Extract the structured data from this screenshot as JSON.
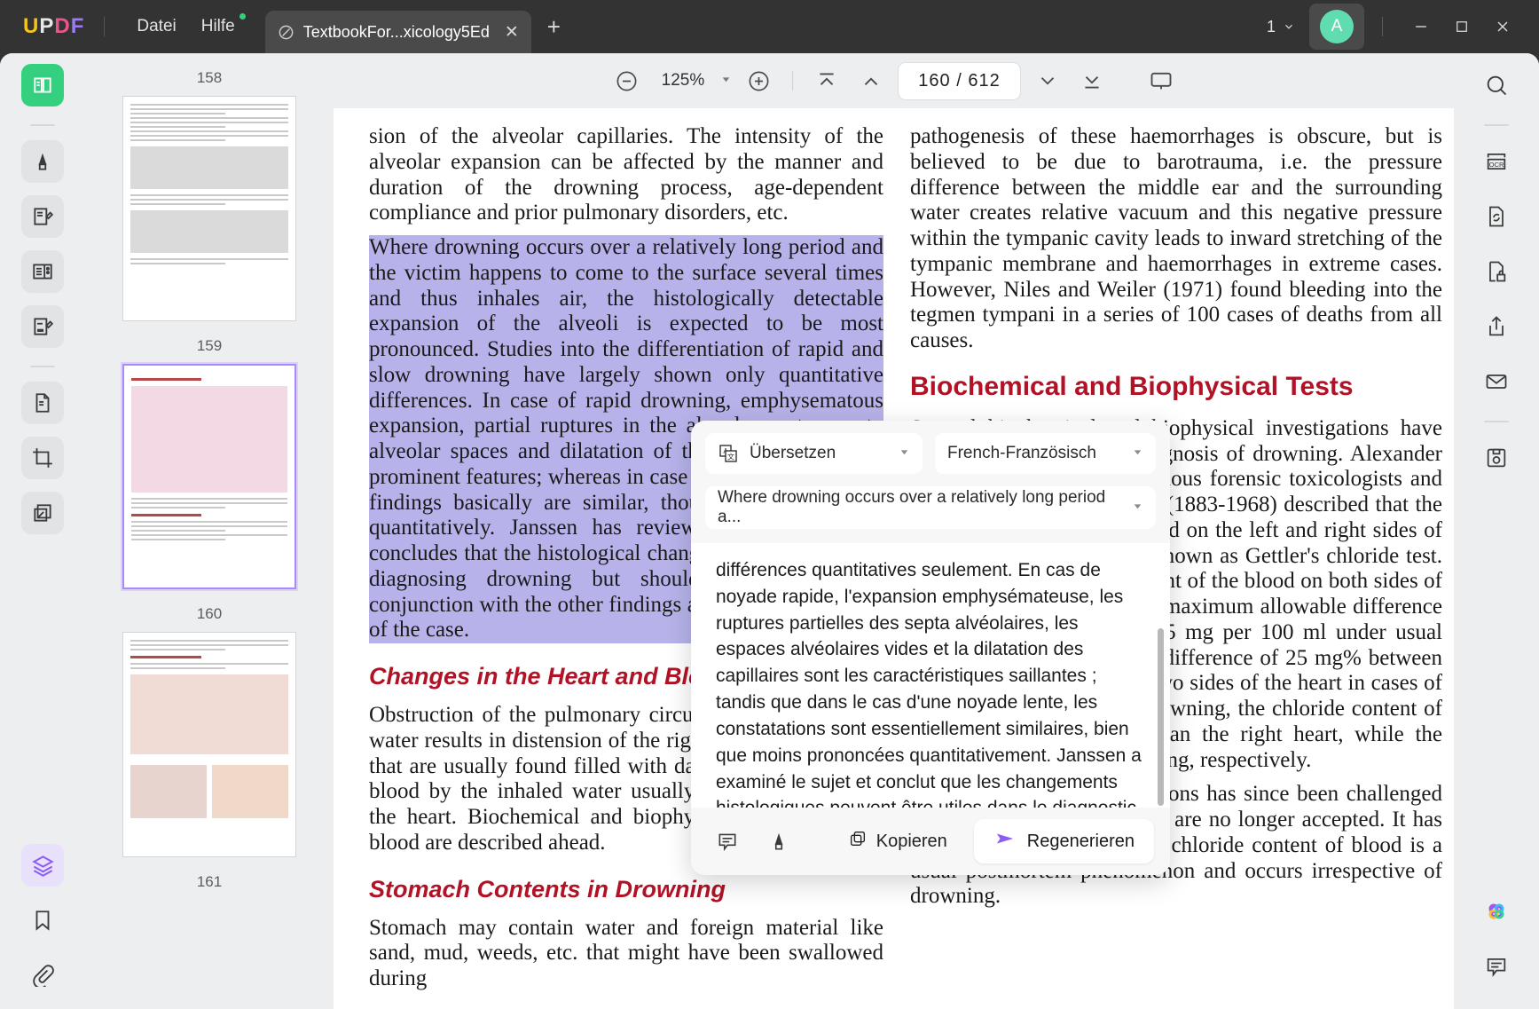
{
  "titlebar": {
    "logo": "UPDF",
    "menu": [
      {
        "label": "Datei",
        "badge": false
      },
      {
        "label": "Hilfe",
        "badge": true
      }
    ],
    "tab": {
      "label": "TextbookFor...xicology5Ed",
      "close": "✕",
      "icon": "document-tab-icon"
    },
    "new_tab": "+",
    "window_count": "1",
    "avatar_letter": "A",
    "minimize": "—",
    "maximize": "☐",
    "close": "✕"
  },
  "left_rail": {
    "items": [
      {
        "name": "reader-mode-icon",
        "state": "active-green"
      },
      {
        "name": "highlighter-icon",
        "state": "normal"
      },
      {
        "name": "edit-pdf-icon",
        "state": "normal"
      },
      {
        "name": "page-form-icon",
        "state": "normal"
      },
      {
        "name": "annotate-icon",
        "state": "normal"
      },
      {
        "name": "organize-pages-icon",
        "state": "normal"
      },
      {
        "name": "crop-page-icon",
        "state": "normal"
      },
      {
        "name": "convert-pdf-icon",
        "state": "normal"
      },
      {
        "name": "layers-icon",
        "state": "active-purple"
      },
      {
        "name": "bookmark-icon",
        "state": "plain"
      },
      {
        "name": "attachment-icon",
        "state": "plain"
      }
    ]
  },
  "thumbnails": {
    "pages": [
      {
        "number": "158",
        "selected": false
      },
      {
        "number": "159",
        "selected": false
      },
      {
        "number": "160",
        "selected": true
      },
      {
        "number": "161",
        "selected": false
      }
    ]
  },
  "doc_toolbar": {
    "zoom_out": "zoom-out-icon",
    "zoom_value": "125%",
    "zoom_in": "zoom-in-icon",
    "first_page": "first-page-icon",
    "prev_page": "previous-page-icon",
    "page_current": "160",
    "page_separator": "/",
    "page_total": "612",
    "next_page": "next-page-icon",
    "last_page": "last-page-icon",
    "present": "presentation-icon"
  },
  "right_rail": {
    "items": [
      {
        "name": "search-icon"
      },
      {
        "name": "ocr-icon"
      },
      {
        "name": "convert-file-icon"
      },
      {
        "name": "protect-document-icon"
      },
      {
        "name": "share-icon"
      },
      {
        "name": "email-icon"
      },
      {
        "name": "save-as-icon"
      },
      {
        "name": "ai-assistant-icon"
      },
      {
        "name": "comment-icon"
      }
    ]
  },
  "document": {
    "left_column": [
      {
        "text": "sion of the alveolar capillaries. The intensity of the alveolar expansion can be affected by the manner and duration of the drowning process, age-dependent compliance and prior pulmonary disorders, etc.",
        "highlight": false
      },
      {
        "text": "Where drowning occurs over a relatively long period and the victim happens to come to the surface several times and thus inhales air, the histologically detectable expansion of the alveoli is expected to be most pronounced. Studies into the differentiation of rapid and slow drowning have largely shown only quantitative differences. In case of rapid drowning, emphysematous expansion, partial ruptures in the alveolar septa, empty alveolar spaces and dilatation of the capillaries are the prominent features; whereas in case of slow drowning the findings basically are similar, though less pronounced quantitatively. Janssen has reviewed the subject and concludes that the histological changes may be helpful in diagnosing drowning but should be evaluated in conjunction with the other findings and the circumstances of the case.",
        "highlight": true
      }
    ],
    "heading_1": "Changes in the Heart and Blood",
    "paragraph_after_heading_1": "Obstruction of the pulmonary circulation by the inhaled water results in distension of the right heart and the veins that are usually found filled with dark blood. Dilution of blood by the inhaled water usually prevents clotting in the heart. Biochemical and biophysical changes in the blood are described ahead.",
    "heading_2": "Stomach Contents in Drowning",
    "paragraph_after_heading_2": "Stomach may contain water and foreign material like sand, mud, weeds, etc. that might have been swallowed during",
    "right_column": [
      "pathogenesis of these haemorrhages is obscure, but is believed to be due to barotrauma, i.e. the pressure difference between the middle ear and the surrounding water creates relative vacuum and this negative pressure within the tympanic cavity leads to inward stretching of the tympanic membrane and haemorrhages in extreme cases. However, Niles and Weiler (1971) found bleeding into the tegmen tympani in a series of 100 cases of deaths from all causes."
    ],
    "right_heading": "Biochemical and Biophysical Tests",
    "right_paragraphs": [
      "Several biochemical and biophysical investigations have been carried out for the diagnosis of drowning. Alexander Gettler, one of the most famous forensic toxicologists and examiners, New York, USA (1883-1968) described that the chloride contents of the blood on the left and right sides of the heart and this test was known as Gettler's chloride test. Normally, the chloride content of the blood on both sides of the heart is the same with a maximum allowable difference between the two sides of 25 mg per 100 ml under usual conditions. There may be a difference of 25 mg% between the chloride content of the two sides of the heart in cases of drowning. In fresh water drowning, the chloride content of the left heart was lower than the right heart, while the reverse happens after drowning, respectively.",
      "The value of these observations has since been challenged by a number of workers and are no longer accepted. It has been shown that changes in chloride content of blood is a usual postmortem phenomenon and occurs irrespective of drowning."
    ]
  },
  "translate_popup": {
    "mode": {
      "label": "Übersetzen",
      "icon": "translate-icon"
    },
    "language": {
      "label": "French-Französisch"
    },
    "source_text": {
      "label": "Where drowning occurs over a relatively long period a..."
    },
    "translation": "différences quantitatives seulement. En cas de noyade rapide, l'expansion emphysémateuse, les ruptures partielles des septa alvéolaires, les espaces alvéolaires vides et la dilatation des capillaires sont les caractéristiques saillantes ; tandis que dans le cas d'une noyade lente, les constatations sont essentiellement similaires, bien que moins prononcées quantitativement. Janssen a examiné le sujet et conclut que les changements histologiques peuvent être utiles dans le diagnostic de la noyade, mais doivent être évalués en conjonction avec les autres constatations et les circonstances de l'affaire.",
    "footer": {
      "comment_icon": "add-comment-icon",
      "highlight_icon": "highlighter-icon",
      "copy_label": "Kopieren",
      "copy_icon": "copy-icon",
      "regenerate_label": "Regenerieren",
      "regenerate_icon": "regenerate-send-icon"
    }
  },
  "colors": {
    "accent_green": "#35d07f",
    "accent_purple": "#8b5cf6",
    "heading_red": "#b11226",
    "highlight": "#b7b3ea",
    "titlebar": "#333333"
  }
}
